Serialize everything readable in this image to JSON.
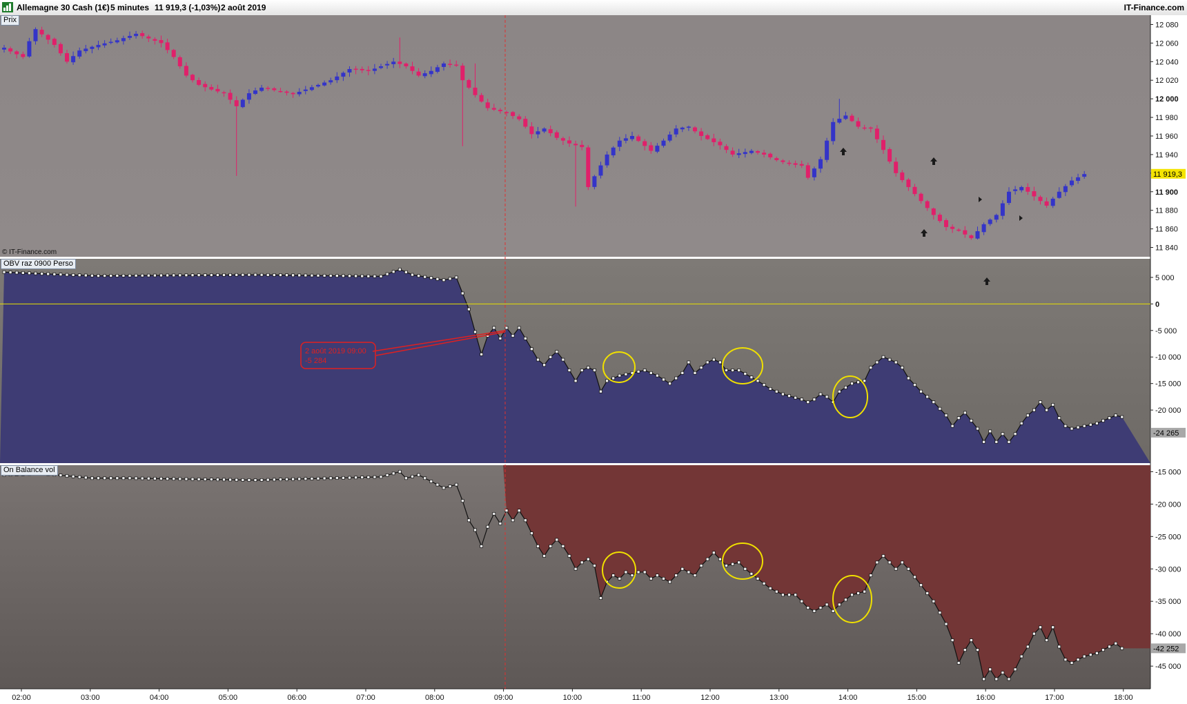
{
  "header": {
    "instrument": "Allemagne 30 Cash (1€)",
    "timeframe": "5 minutes",
    "quote": "11 919,3 (-1,03%)",
    "date": "2 août 2019",
    "brand": "IT-Finance.com"
  },
  "panels": {
    "price_label": "Prix",
    "obv_label": "OBV raz 0900 Perso",
    "obv_vol_label": "On Balance vol",
    "copyright": "© IT-Finance.com"
  },
  "colors": {
    "bull_candle": "#3434c8",
    "bear_candle": "#e0206a",
    "price_bg_top": "#8c8686",
    "price_bg_bottom": "#8f8888",
    "obv_fill": "#3e3c74",
    "obv_vol_fill": "#733636",
    "zero_line": "#e8e000",
    "highlight_circle": "#f0e000",
    "session_line": "#e03030",
    "last_price_box": "#f4e400"
  },
  "annotation": {
    "line1": "2 août 2019 09:00",
    "line2": "-5 284"
  },
  "chart_data": [
    {
      "type": "candlestick",
      "name": "Prix",
      "x_ticks": [
        "02:00",
        "03:00",
        "04:00",
        "05:00",
        "06:00",
        "07:00",
        "08:00",
        "09:00",
        "10:00",
        "11:00",
        "12:00",
        "13:00",
        "14:00",
        "15:00",
        "16:00",
        "17:00",
        "18:00"
      ],
      "y_ticks": [
        "12 080",
        "12 060",
        "12 040",
        "12 020",
        "12 000",
        "11 980",
        "11 960",
        "11 940",
        "11 920",
        "11 900",
        "11 880",
        "11 860",
        "11 840"
      ],
      "ylim": [
        11830,
        12090
      ],
      "last_price": "11 919,3",
      "anchors_time_close": [
        [
          0,
          12055
        ],
        [
          1,
          12051
        ],
        [
          3,
          12045
        ],
        [
          4,
          12062
        ],
        [
          5,
          12075
        ],
        [
          8,
          12058
        ],
        [
          10,
          12040
        ],
        [
          12,
          12052
        ],
        [
          15,
          12058
        ],
        [
          18,
          12063
        ],
        [
          21,
          12070
        ],
        [
          25,
          12060
        ],
        [
          27,
          12045
        ],
        [
          29,
          12025
        ],
        [
          31,
          12015
        ],
        [
          33,
          12010
        ],
        [
          35,
          12006
        ],
        [
          37,
          11992
        ],
        [
          39,
          12006
        ],
        [
          41,
          12012
        ],
        [
          44,
          12008
        ],
        [
          46,
          12005
        ],
        [
          48,
          12010
        ],
        [
          52,
          12020
        ],
        [
          55,
          12032
        ],
        [
          58,
          12030
        ],
        [
          62,
          12040
        ],
        [
          64,
          12035
        ],
        [
          66,
          12025
        ],
        [
          68,
          12030
        ],
        [
          70,
          12038
        ],
        [
          72,
          12036
        ],
        [
          73,
          12020
        ],
        [
          75,
          12004
        ],
        [
          77,
          11990
        ],
        [
          80,
          11985
        ],
        [
          82,
          11978
        ],
        [
          84,
          11962
        ],
        [
          86,
          11968
        ],
        [
          88,
          11958
        ],
        [
          90,
          11952
        ],
        [
          92,
          11948
        ],
        [
          93,
          11905
        ],
        [
          96,
          11940
        ],
        [
          98,
          11955
        ],
        [
          100,
          11960
        ],
        [
          103,
          11944
        ],
        [
          105,
          11955
        ],
        [
          107,
          11968
        ],
        [
          109,
          11970
        ],
        [
          111,
          11960
        ],
        [
          114,
          11950
        ],
        [
          116,
          11940
        ],
        [
          119,
          11944
        ],
        [
          121,
          11940
        ],
        [
          123,
          11934
        ],
        [
          125,
          11930
        ],
        [
          127,
          11928
        ],
        [
          128,
          11915
        ],
        [
          130,
          11935
        ],
        [
          132,
          11975
        ],
        [
          134,
          11982
        ],
        [
          136,
          11970
        ],
        [
          138,
          11968
        ],
        [
          140,
          11945
        ],
        [
          142,
          11920
        ],
        [
          144,
          11905
        ],
        [
          146,
          11890
        ],
        [
          148,
          11875
        ],
        [
          150,
          11862
        ],
        [
          152,
          11858
        ],
        [
          154,
          11850
        ],
        [
          156,
          11865
        ],
        [
          158,
          11875
        ],
        [
          160,
          11900
        ],
        [
          162,
          11905
        ],
        [
          164,
          11895
        ],
        [
          166,
          11885
        ],
        [
          168,
          11900
        ],
        [
          170,
          11912
        ],
        [
          172,
          11919
        ]
      ]
    },
    {
      "type": "area",
      "name": "OBV raz 0900 Perso",
      "y_ticks": [
        "5 000",
        "0",
        "-5 000",
        "-10 000",
        "-15 000",
        "-20 000"
      ],
      "ylim": [
        -30000,
        8500
      ],
      "last_value": "-24 265",
      "reference_line": 0,
      "anchors_time_value": [
        [
          0,
          6000
        ],
        [
          10,
          5500
        ],
        [
          15,
          5300
        ],
        [
          40,
          5500
        ],
        [
          60,
          5200
        ],
        [
          63,
          6500
        ],
        [
          65,
          5500
        ],
        [
          70,
          4500
        ],
        [
          72,
          5000
        ],
        [
          74,
          -1000
        ],
        [
          75,
          -5284
        ],
        [
          76,
          -9500
        ],
        [
          77,
          -6000
        ],
        [
          78,
          -4500
        ],
        [
          79,
          -6500
        ],
        [
          80,
          -4500
        ],
        [
          81,
          -6000
        ],
        [
          82,
          -4500
        ],
        [
          83,
          -6500
        ],
        [
          84,
          -8500
        ],
        [
          85,
          -10500
        ],
        [
          86,
          -11500
        ],
        [
          87,
          -10000
        ],
        [
          88,
          -9000
        ],
        [
          89,
          -10500
        ],
        [
          90,
          -12500
        ],
        [
          91,
          -14500
        ],
        [
          92,
          -12500
        ],
        [
          93,
          -12000
        ],
        [
          94,
          -12500
        ],
        [
          95,
          -16500
        ],
        [
          96,
          -14500
        ],
        [
          98,
          -13500
        ],
        [
          100,
          -13000
        ],
        [
          102,
          -12500
        ],
        [
          104,
          -13500
        ],
        [
          106,
          -15000
        ],
        [
          108,
          -13000
        ],
        [
          109,
          -11000
        ],
        [
          110,
          -13000
        ],
        [
          111,
          -12000
        ],
        [
          112,
          -11000
        ],
        [
          113,
          -10500
        ],
        [
          114,
          -11000
        ],
        [
          115,
          -12500
        ],
        [
          117,
          -12500
        ],
        [
          120,
          -14500
        ],
        [
          122,
          -16000
        ],
        [
          124,
          -17000
        ],
        [
          127,
          -18000
        ],
        [
          128,
          -18500
        ],
        [
          129,
          -18000
        ],
        [
          130,
          -17000
        ],
        [
          131,
          -17500
        ],
        [
          132,
          -18500
        ],
        [
          133,
          -16500
        ],
        [
          135,
          -15000
        ],
        [
          137,
          -14500
        ],
        [
          138,
          -12000
        ],
        [
          139,
          -11000
        ],
        [
          140,
          -10000
        ],
        [
          142,
          -11000
        ],
        [
          143,
          -12000
        ],
        [
          144,
          -14000
        ],
        [
          146,
          -16500
        ],
        [
          148,
          -18500
        ],
        [
          150,
          -21000
        ],
        [
          151,
          -23000
        ],
        [
          152,
          -21500
        ],
        [
          153,
          -20500
        ],
        [
          154,
          -22000
        ],
        [
          155,
          -23500
        ],
        [
          156,
          -26000
        ],
        [
          157,
          -24000
        ],
        [
          158,
          -26000
        ],
        [
          159,
          -24500
        ],
        [
          160,
          -26000
        ],
        [
          161,
          -24500
        ],
        [
          162,
          -22500
        ],
        [
          163,
          -21000
        ],
        [
          164,
          -20000
        ],
        [
          165,
          -18500
        ],
        [
          166,
          -20000
        ],
        [
          167,
          -19000
        ],
        [
          168,
          -21500
        ],
        [
          169,
          -23000
        ],
        [
          170,
          -23500
        ],
        [
          172,
          -23000
        ],
        [
          174,
          -22500
        ],
        [
          176,
          -21500
        ],
        [
          177,
          -21000
        ],
        [
          178,
          -21300
        ]
      ]
    },
    {
      "type": "area",
      "name": "On Balance vol",
      "y_ticks": [
        "-15 000",
        "-20 000",
        "-25 000",
        "-30 000",
        "-35 000",
        "-40 000",
        "-45 000"
      ],
      "ylim": [
        -48500,
        -14000
      ],
      "last_value": "-42 252",
      "anchors_time_value": [
        [
          0,
          -15500
        ],
        [
          6,
          -15300
        ],
        [
          14,
          -16000
        ],
        [
          20,
          -16000
        ],
        [
          40,
          -16300
        ],
        [
          60,
          -15800
        ],
        [
          63,
          -15000
        ],
        [
          64,
          -16000
        ],
        [
          66,
          -15500
        ],
        [
          68,
          -16500
        ],
        [
          70,
          -17500
        ],
        [
          72,
          -17000
        ],
        [
          73,
          -19500
        ],
        [
          74,
          -22500
        ],
        [
          75,
          -24000
        ],
        [
          76,
          -26500
        ],
        [
          77,
          -23500
        ],
        [
          78,
          -21500
        ],
        [
          79,
          -23000
        ],
        [
          80,
          -21000
        ],
        [
          81,
          -22500
        ],
        [
          82,
          -21000
        ],
        [
          83,
          -22500
        ],
        [
          84,
          -24500
        ],
        [
          85,
          -26500
        ],
        [
          86,
          -28000
        ],
        [
          87,
          -26500
        ],
        [
          88,
          -25500
        ],
        [
          89,
          -26500
        ],
        [
          90,
          -28000
        ],
        [
          91,
          -30000
        ],
        [
          92,
          -29000
        ],
        [
          93,
          -28500
        ],
        [
          94,
          -29500
        ],
        [
          95,
          -34500
        ],
        [
          96,
          -32000
        ],
        [
          97,
          -31000
        ],
        [
          98,
          -31500
        ],
        [
          99,
          -30500
        ],
        [
          100,
          -31000
        ],
        [
          101,
          -30500
        ],
        [
          102,
          -30500
        ],
        [
          103,
          -31500
        ],
        [
          104,
          -31000
        ],
        [
          106,
          -32000
        ],
        [
          108,
          -30000
        ],
        [
          110,
          -31000
        ],
        [
          111,
          -29500
        ],
        [
          112,
          -28500
        ],
        [
          113,
          -27500
        ],
        [
          114,
          -28500
        ],
        [
          115,
          -29500
        ],
        [
          117,
          -29000
        ],
        [
          118,
          -30000
        ],
        [
          120,
          -31500
        ],
        [
          122,
          -33000
        ],
        [
          124,
          -34000
        ],
        [
          126,
          -34000
        ],
        [
          127,
          -35000
        ],
        [
          128,
          -36000
        ],
        [
          129,
          -36500
        ],
        [
          130,
          -36000
        ],
        [
          131,
          -35500
        ],
        [
          132,
          -36500
        ],
        [
          133,
          -35500
        ],
        [
          135,
          -34000
        ],
        [
          137,
          -33500
        ],
        [
          138,
          -31000
        ],
        [
          139,
          -29000
        ],
        [
          140,
          -28000
        ],
        [
          141,
          -29000
        ],
        [
          142,
          -30000
        ],
        [
          143,
          -29000
        ],
        [
          144,
          -30000
        ],
        [
          146,
          -32500
        ],
        [
          148,
          -35000
        ],
        [
          150,
          -38500
        ],
        [
          151,
          -41000
        ],
        [
          152,
          -44500
        ],
        [
          153,
          -42500
        ],
        [
          154,
          -41000
        ],
        [
          155,
          -42500
        ],
        [
          156,
          -47000
        ],
        [
          157,
          -45500
        ],
        [
          158,
          -47000
        ],
        [
          159,
          -46000
        ],
        [
          160,
          -47000
        ],
        [
          161,
          -45500
        ],
        [
          162,
          -43500
        ],
        [
          163,
          -42000
        ],
        [
          164,
          -40000
        ],
        [
          165,
          -39000
        ],
        [
          166,
          -41000
        ],
        [
          167,
          -39000
        ],
        [
          168,
          -42000
        ],
        [
          169,
          -44000
        ],
        [
          170,
          -44500
        ],
        [
          172,
          -43500
        ],
        [
          174,
          -43000
        ],
        [
          176,
          -42000
        ],
        [
          177,
          -41500
        ],
        [
          178,
          -42252
        ]
      ]
    }
  ]
}
